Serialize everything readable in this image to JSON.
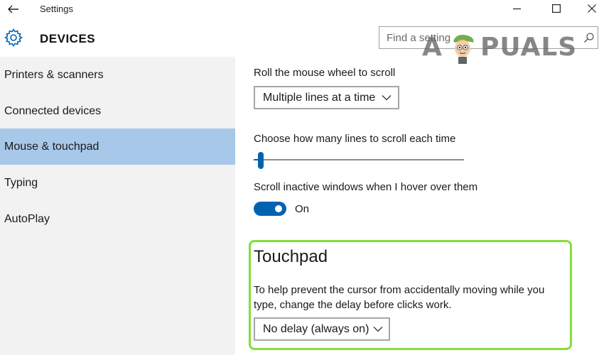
{
  "window": {
    "title": "Settings"
  },
  "header": {
    "section_title": "DEVICES",
    "search_placeholder": "Find a setting"
  },
  "watermark": {
    "letter_a": "A",
    "rest": "PUALS"
  },
  "sidebar": {
    "items": [
      {
        "label": "Printers & scanners",
        "active": false
      },
      {
        "label": "Connected devices",
        "active": false
      },
      {
        "label": "Mouse & touchpad",
        "active": true
      },
      {
        "label": "Typing",
        "active": false
      },
      {
        "label": "AutoPlay",
        "active": false
      }
    ]
  },
  "main": {
    "scroll_wheel": {
      "label": "Roll the mouse wheel to scroll",
      "selected": "Multiple lines at a time"
    },
    "lines_to_scroll": {
      "label": "Choose how many lines to scroll each time",
      "slider_fraction": 0.02
    },
    "scroll_inactive": {
      "label": "Scroll inactive windows when I hover over them",
      "state_label": "On",
      "on": true
    },
    "touchpad": {
      "heading": "Touchpad",
      "description": "To help prevent the cursor from accidentally moving while you type, change the delay before clicks work.",
      "delay_selected": "No delay (always on)"
    }
  },
  "colors": {
    "accent": "#0063b1",
    "sidebar_selected": "#a7c8e9",
    "sidebar_bg": "#f2f2f2",
    "highlight_border": "#82df3a"
  }
}
